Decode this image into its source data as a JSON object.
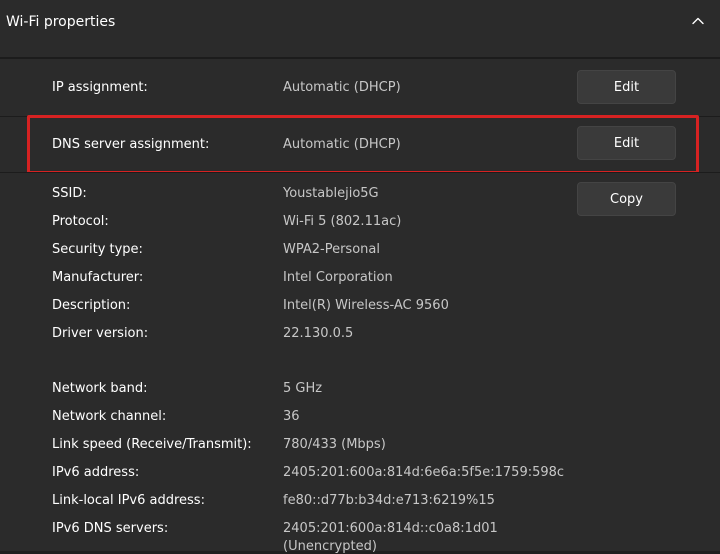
{
  "header": {
    "title": "Wi-Fi properties",
    "collapse_icon": "chevron-up-icon"
  },
  "ip": {
    "label": "IP assignment:",
    "value": "Automatic (DHCP)",
    "button": "Edit"
  },
  "dns": {
    "label": "DNS server assignment:",
    "value": "Automatic (DHCP)",
    "button": "Edit"
  },
  "copy_button": "Copy",
  "group1": [
    {
      "label": "SSID:",
      "value": "Youstablejio5G"
    },
    {
      "label": "Protocol:",
      "value": "Wi-Fi 5 (802.11ac)"
    },
    {
      "label": "Security type:",
      "value": "WPA2-Personal"
    },
    {
      "label": "Manufacturer:",
      "value": "Intel Corporation"
    },
    {
      "label": "Description:",
      "value": "Intel(R) Wireless-AC 9560"
    },
    {
      "label": "Driver version:",
      "value": "22.130.0.5"
    }
  ],
  "group2": [
    {
      "label": "Network band:",
      "value": "5 GHz"
    },
    {
      "label": "Network channel:",
      "value": "36"
    },
    {
      "label": "Link speed (Receive/Transmit):",
      "value": "780/433 (Mbps)"
    },
    {
      "label": "IPv6 address:",
      "value": "2405:201:600a:814d:6e6a:5f5e:1759:598c"
    },
    {
      "label": "Link-local IPv6 address:",
      "value": "fe80::d77b:b34d:e713:6219%15"
    },
    {
      "label": "IPv6 DNS servers:",
      "value": "2405:201:600a:814d::c0a8:1d01"
    }
  ],
  "ipv6_dns_note": "(Unencrypted)",
  "colors": {
    "highlight": "#d62222",
    "background": "#2b2b2b"
  }
}
